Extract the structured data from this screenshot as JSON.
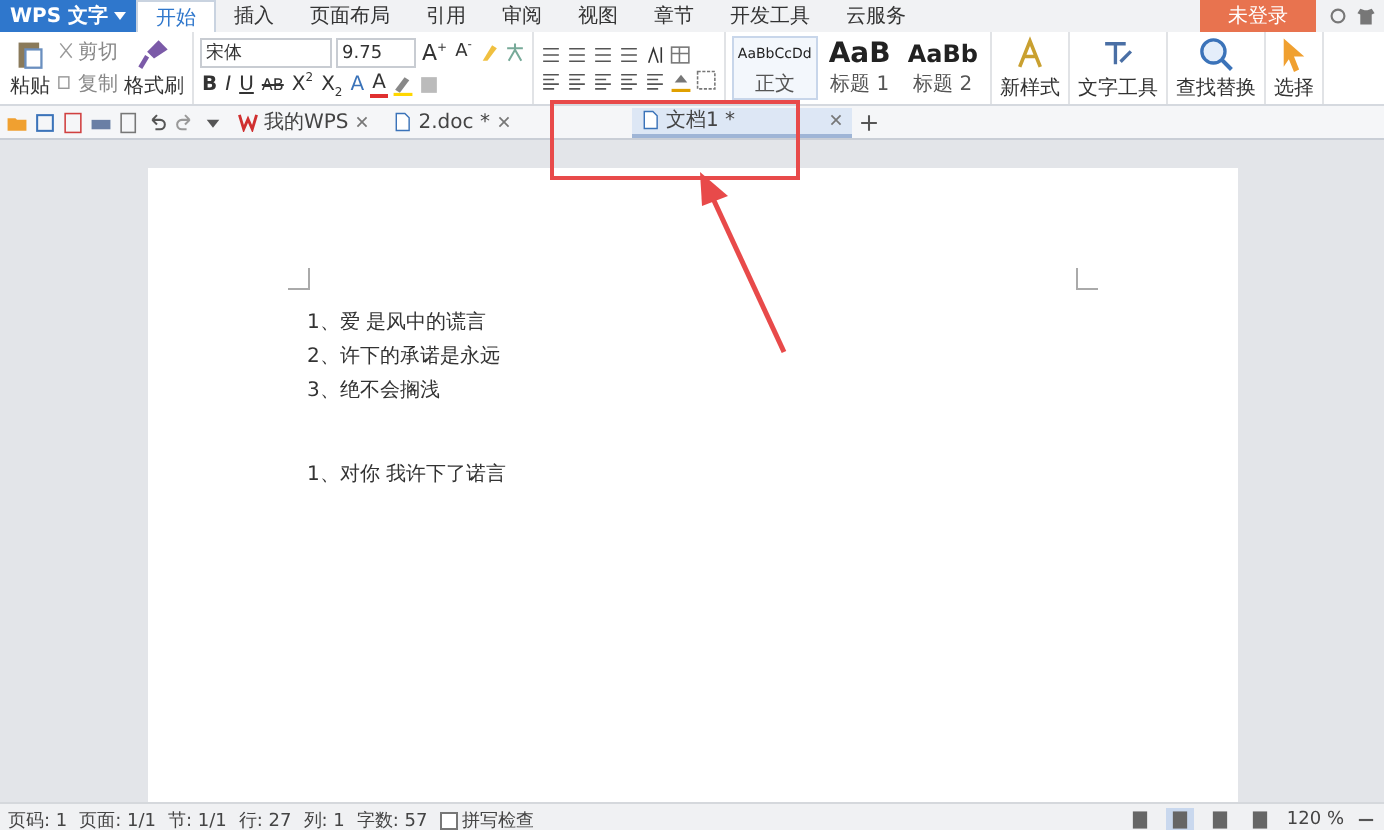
{
  "app_menu": {
    "label": "WPS 文字"
  },
  "menu_tabs": [
    {
      "label": "开始",
      "selected": true
    },
    {
      "label": "插入",
      "selected": false
    },
    {
      "label": "页面布局",
      "selected": false
    },
    {
      "label": "引用",
      "selected": false
    },
    {
      "label": "审阅",
      "selected": false
    },
    {
      "label": "视图",
      "selected": false
    },
    {
      "label": "章节",
      "selected": false
    },
    {
      "label": "开发工具",
      "selected": false
    },
    {
      "label": "云服务",
      "selected": false
    }
  ],
  "login_button": {
    "label": "未登录"
  },
  "ribbon": {
    "clipboard": {
      "paste": "粘贴",
      "cut": "剪切",
      "copy": "复制",
      "format_painter": "格式刷"
    },
    "font": {
      "name": "宋体",
      "size": "9.75"
    },
    "font_row_buttons": [
      {
        "glyph": "A$^{+}$",
        "kind": "grow"
      },
      {
        "glyph": "A$^{-}$",
        "kind": "shrink"
      }
    ],
    "format_buttons": [
      {
        "glyph": "B",
        "kind": "bold"
      },
      {
        "glyph": "I",
        "kind": "italic"
      },
      {
        "glyph": "U",
        "kind": "underline"
      },
      {
        "glyph": "AB",
        "kind": "strike"
      },
      {
        "glyph": "X$^{2}$",
        "kind": "plain"
      },
      {
        "glyph": "X$_{2}$",
        "kind": "plain"
      },
      {
        "glyph": "A",
        "kind": "effect"
      },
      {
        "glyph": "A",
        "kind": "color"
      }
    ],
    "styles": [
      {
        "sample": "AaBbCcDd",
        "label": "正文",
        "kind": "normal"
      },
      {
        "sample": "AaB",
        "label": "标题 1",
        "kind": "heading1"
      },
      {
        "sample": "AaBb",
        "label": "标题 2",
        "kind": "heading2"
      }
    ],
    "tools": [
      {
        "label": "新样式",
        "kind": "style"
      },
      {
        "label": "文字工具",
        "kind": "text"
      },
      {
        "label": "查找替换",
        "kind": "find"
      },
      {
        "label": "选择",
        "kind": "select"
      }
    ]
  },
  "doc_tabs": [
    {
      "label": "我的WPS",
      "kind": "home",
      "selected": false
    },
    {
      "label": "2.doc *",
      "kind": "doc",
      "selected": false
    },
    {
      "label": "文档1 *",
      "kind": "doc",
      "selected": true
    }
  ],
  "document": {
    "paragraph_groups": [
      [
        "1、爱 是风中的谎言",
        "2、许下的承诺是永远",
        "3、绝不会搁浅"
      ],
      [
        "1、对你 我许下了诺言"
      ]
    ]
  },
  "status_bar": {
    "items": [
      "页码: 1",
      "页面: 1/1",
      "节: 1/1",
      "行: 27",
      "列: 1",
      "字数: 57"
    ],
    "spell_check": {
      "label": "拼写检查",
      "checked": false
    },
    "view_modes": [
      {
        "selected": false
      },
      {
        "selected": true
      },
      {
        "selected": false
      },
      {
        "selected": false
      }
    ],
    "zoom": "120 %"
  }
}
